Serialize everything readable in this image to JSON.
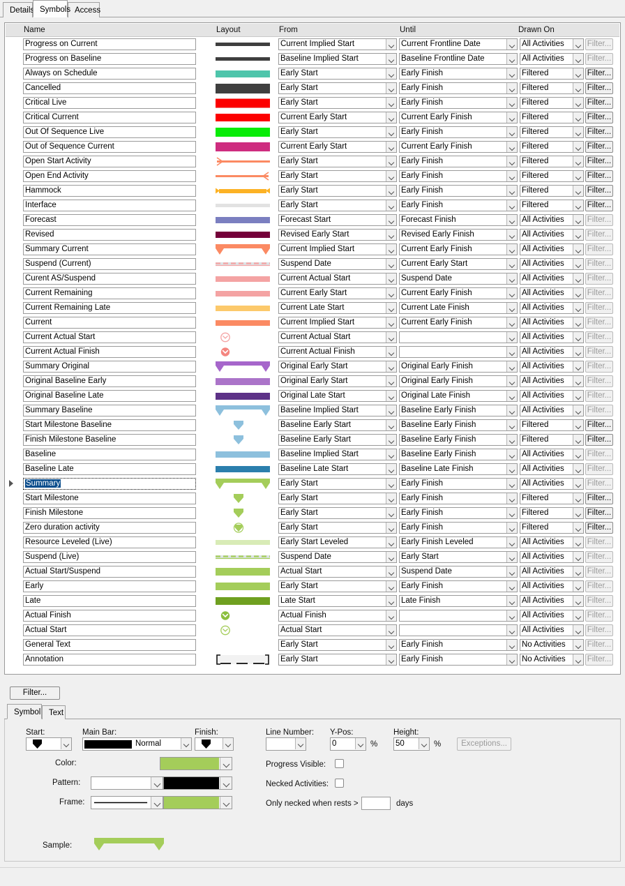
{
  "tabs": [
    {
      "label": "Details",
      "active": false
    },
    {
      "label": "Symbols",
      "active": true
    },
    {
      "label": "Access",
      "active": false
    }
  ],
  "grid": {
    "columns": [
      {
        "key": "name",
        "label": "Name"
      },
      {
        "key": "layout",
        "label": "Layout"
      },
      {
        "key": "from",
        "label": "From"
      },
      {
        "key": "until",
        "label": "Until"
      },
      {
        "key": "drawn_on",
        "label": "Drawn On"
      },
      {
        "key": "filter",
        "label": ""
      }
    ],
    "filter_button_label": "Filter...",
    "rows": [
      {
        "name": "Progress on Current",
        "from": "Current Implied Start",
        "until": "Current Frontline Date",
        "drawn_on": "All Activities",
        "filter_enabled": false,
        "selected": false,
        "sym": {
          "kind": "bar",
          "color": "#3f3f3f",
          "h": 5
        }
      },
      {
        "name": "Progress on Baseline",
        "from": "Baseline Implied Start",
        "until": "Baseline Frontline Date",
        "drawn_on": "All Activities",
        "filter_enabled": false,
        "selected": false,
        "sym": {
          "kind": "bar",
          "color": "#3f3f3f",
          "h": 5
        }
      },
      {
        "name": "Always on Schedule",
        "from": "Early Start",
        "until": "Early Finish",
        "drawn_on": "Filtered",
        "filter_enabled": true,
        "selected": false,
        "sym": {
          "kind": "bar",
          "color": "#4ec5ab",
          "h": 10
        }
      },
      {
        "name": "Cancelled",
        "from": "Early Start",
        "until": "Early Finish",
        "drawn_on": "Filtered",
        "filter_enabled": true,
        "selected": false,
        "sym": {
          "kind": "bar",
          "color": "#3f3f3f",
          "h": 14
        }
      },
      {
        "name": "Critical Live",
        "from": "Early Start",
        "until": "Early Finish",
        "drawn_on": "Filtered",
        "filter_enabled": true,
        "selected": false,
        "sym": {
          "kind": "bar",
          "color": "#fc0000",
          "h": 12,
          "frame": "#f08080"
        }
      },
      {
        "name": "Critical Current",
        "from": "Current Early Start",
        "until": "Current Early Finish",
        "drawn_on": "Filtered",
        "filter_enabled": true,
        "selected": false,
        "sym": {
          "kind": "bar",
          "color": "#fc0000",
          "h": 11
        }
      },
      {
        "name": "Out Of Sequence Live",
        "from": "Early Start",
        "until": "Early Finish",
        "drawn_on": "Filtered",
        "filter_enabled": true,
        "selected": false,
        "sym": {
          "kind": "bar",
          "color": "#08ec08",
          "h": 13
        }
      },
      {
        "name": "Out of Sequence Current",
        "from": "Current Early Start",
        "until": "Current Early Finish",
        "drawn_on": "Filtered",
        "filter_enabled": true,
        "selected": false,
        "sym": {
          "kind": "bar",
          "color": "#ce2d7f",
          "h": 13
        }
      },
      {
        "name": "Open Start Activity",
        "from": "Early Start",
        "until": "Early Finish",
        "drawn_on": "Filtered",
        "filter_enabled": true,
        "selected": false,
        "sym": {
          "kind": "open-start",
          "color": "#fb8a63",
          "h": 3
        }
      },
      {
        "name": "Open End Activity",
        "from": "Early Start",
        "until": "Early Finish",
        "drawn_on": "Filtered",
        "filter_enabled": true,
        "selected": false,
        "sym": {
          "kind": "open-end",
          "color": "#fb8a63",
          "h": 3
        }
      },
      {
        "name": "Hammock",
        "from": "Early Start",
        "until": "Early Finish",
        "drawn_on": "Filtered",
        "filter_enabled": true,
        "selected": false,
        "sym": {
          "kind": "hammock",
          "color": "#fcb225",
          "h": 6
        }
      },
      {
        "name": "Interface",
        "from": "Early Start",
        "until": "Early Finish",
        "drawn_on": "Filtered",
        "filter_enabled": true,
        "selected": false,
        "sym": {
          "kind": "bar",
          "color": "#e2e2e2",
          "h": 5
        }
      },
      {
        "name": "Forecast",
        "from": "Forecast Start",
        "until": "Forecast Finish",
        "drawn_on": "All Activities",
        "filter_enabled": false,
        "selected": false,
        "sym": {
          "kind": "bar",
          "color": "#7b7fc0",
          "h": 9
        }
      },
      {
        "name": "Revised",
        "from": "Revised Early Start",
        "until": "Revised Early Finish",
        "drawn_on": "All Activities",
        "filter_enabled": false,
        "selected": false,
        "sym": {
          "kind": "bar",
          "color": "#740039",
          "h": 9
        }
      },
      {
        "name": "Summary Current",
        "from": "Current Implied Start",
        "until": "Current Early Finish",
        "drawn_on": "All Activities",
        "filter_enabled": false,
        "selected": false,
        "sym": {
          "kind": "summary",
          "color": "#fb8a63",
          "h": 15
        }
      },
      {
        "name": "Suspend (Current)",
        "from": "Suspend Date",
        "until": "Current Early Start",
        "drawn_on": "All Activities",
        "filter_enabled": false,
        "selected": false,
        "sym": {
          "kind": "dashed",
          "color": "#f4a3a3",
          "h": 5
        }
      },
      {
        "name": "Curent AS/Suspend",
        "from": "Current Actual Start",
        "until": "Suspend Date",
        "drawn_on": "All Activities",
        "filter_enabled": false,
        "selected": false,
        "sym": {
          "kind": "bar",
          "color": "#f4a3a3",
          "h": 8
        }
      },
      {
        "name": "Current Remaining",
        "from": "Current Early Start",
        "until": "Current Early Finish",
        "drawn_on": "All Activities",
        "filter_enabled": false,
        "selected": false,
        "sym": {
          "kind": "bar",
          "color": "#f4a3a3",
          "h": 8
        }
      },
      {
        "name": "Current Remaining Late",
        "from": "Current Late Start",
        "until": "Current Late Finish",
        "drawn_on": "All Activities",
        "filter_enabled": false,
        "selected": false,
        "sym": {
          "kind": "bar",
          "color": "#fcc96b",
          "h": 8
        }
      },
      {
        "name": "Current",
        "from": "Current Implied Start",
        "until": "Current Early Finish",
        "drawn_on": "All Activities",
        "filter_enabled": false,
        "selected": false,
        "sym": {
          "kind": "bar",
          "color": "#fb8a63",
          "h": 8
        }
      },
      {
        "name": "Current Actual Start",
        "from": "Current Actual Start",
        "until": "",
        "drawn_on": "All Activities",
        "filter_enabled": false,
        "selected": false,
        "sym": {
          "kind": "circle-hollow",
          "color": "#f4a3a3",
          "h": 13
        }
      },
      {
        "name": "Current Actual Finish",
        "from": "Current Actual Finish",
        "until": "",
        "drawn_on": "All Activities",
        "filter_enabled": false,
        "selected": false,
        "sym": {
          "kind": "circle-solid",
          "color": "#f4857f",
          "h": 13
        }
      },
      {
        "name": "Summary Original",
        "from": "Original Early Start",
        "until": "Original Early Finish",
        "drawn_on": "All Activities",
        "filter_enabled": false,
        "selected": false,
        "sym": {
          "kind": "summary",
          "color": "#a666cb",
          "h": 15
        }
      },
      {
        "name": "Original Baseline Early",
        "from": "Original Early Start",
        "until": "Original Early Finish",
        "drawn_on": "All Activities",
        "filter_enabled": false,
        "selected": false,
        "sym": {
          "kind": "bar",
          "color": "#ab74c9",
          "h": 10
        }
      },
      {
        "name": "Original Baseline Late",
        "from": "Original Late Start",
        "until": "Original Late Finish",
        "drawn_on": "All Activities",
        "filter_enabled": false,
        "selected": false,
        "sym": {
          "kind": "bar",
          "color": "#5d3287",
          "h": 10
        }
      },
      {
        "name": "Summary Baseline",
        "from": "Baseline Implied Start",
        "until": "Baseline Early Finish",
        "drawn_on": "All Activities",
        "filter_enabled": false,
        "selected": false,
        "sym": {
          "kind": "summary",
          "color": "#8dc0dd",
          "h": 15
        }
      },
      {
        "name": "Start Milestone Baseline",
        "from": "Baseline Early Start",
        "until": "Baseline Early Finish",
        "drawn_on": "Filtered",
        "filter_enabled": true,
        "selected": false,
        "sym": {
          "kind": "milestone",
          "color": "#8dc0dd",
          "h": 13
        }
      },
      {
        "name": "Finish Milestone Baseline",
        "from": "Baseline Early Start",
        "until": "Baseline Early Finish",
        "drawn_on": "Filtered",
        "filter_enabled": true,
        "selected": false,
        "sym": {
          "kind": "milestone",
          "color": "#8dc0dd",
          "h": 13
        }
      },
      {
        "name": "Baseline",
        "from": "Baseline Implied Start",
        "until": "Baseline Early Finish",
        "drawn_on": "All Activities",
        "filter_enabled": false,
        "selected": false,
        "sym": {
          "kind": "bar",
          "color": "#8dc0dd",
          "h": 9
        }
      },
      {
        "name": "Baseline Late",
        "from": "Baseline Late Start",
        "until": "Baseline Late Finish",
        "drawn_on": "All Activities",
        "filter_enabled": false,
        "selected": false,
        "sym": {
          "kind": "bar",
          "color": "#2b7fad",
          "h": 9
        }
      },
      {
        "name": "Summary",
        "from": "Early Start",
        "until": "Early Finish",
        "drawn_on": "All Activities",
        "filter_enabled": false,
        "selected": true,
        "sym": {
          "kind": "summary",
          "color": "#a4cd5a",
          "h": 15
        }
      },
      {
        "name": "Start Milestone",
        "from": "Early Start",
        "until": "Early Finish",
        "drawn_on": "Filtered",
        "filter_enabled": true,
        "selected": false,
        "sym": {
          "kind": "milestone",
          "color": "#a4cd5a",
          "h": 13
        }
      },
      {
        "name": "Finish Milestone",
        "from": "Early Start",
        "until": "Early Finish",
        "drawn_on": "Filtered",
        "filter_enabled": true,
        "selected": false,
        "sym": {
          "kind": "milestone",
          "color": "#a4cd5a",
          "h": 13
        }
      },
      {
        "name": "Zero duration activity",
        "from": "Early Start",
        "until": "Early Finish",
        "drawn_on": "Filtered",
        "filter_enabled": true,
        "selected": false,
        "sym": {
          "kind": "zero-dur",
          "color": "#a4cd5a",
          "h": 14
        }
      },
      {
        "name": "Resource Leveled (Live)",
        "from": "Early Start Leveled",
        "until": "Early Finish Leveled",
        "drawn_on": "All Activities",
        "filter_enabled": false,
        "selected": false,
        "sym": {
          "kind": "bar",
          "color": "#d8ebb6",
          "h": 7
        }
      },
      {
        "name": "Suspend (Live)",
        "from": "Suspend Date",
        "until": "Early Start",
        "drawn_on": "All Activities",
        "filter_enabled": false,
        "selected": false,
        "sym": {
          "kind": "dashed",
          "color": "#a4cd5a",
          "h": 5
        }
      },
      {
        "name": "Actual Start/Suspend",
        "from": "Actual Start",
        "until": "Suspend Date",
        "drawn_on": "All Activities",
        "filter_enabled": false,
        "selected": false,
        "sym": {
          "kind": "bar",
          "color": "#a4cd5a",
          "h": 11
        }
      },
      {
        "name": "Early",
        "from": "Early Start",
        "until": "Early Finish",
        "drawn_on": "All Activities",
        "filter_enabled": false,
        "selected": false,
        "sym": {
          "kind": "bar",
          "color": "#a4cd5a",
          "h": 11
        }
      },
      {
        "name": "Late",
        "from": "Late Start",
        "until": "Late Finish",
        "drawn_on": "All Activities",
        "filter_enabled": false,
        "selected": false,
        "sym": {
          "kind": "bar",
          "color": "#6fa020",
          "h": 11
        }
      },
      {
        "name": "Actual Finish",
        "from": "Actual Finish",
        "until": "",
        "drawn_on": "All Activities",
        "filter_enabled": false,
        "selected": false,
        "sym": {
          "kind": "circle-solid",
          "color": "#8cbf3f",
          "h": 13
        }
      },
      {
        "name": "Actual Start",
        "from": "Actual Start",
        "until": "",
        "drawn_on": "All Activities",
        "filter_enabled": false,
        "selected": false,
        "sym": {
          "kind": "circle-hollow",
          "color": "#a4cd5a",
          "h": 13
        }
      },
      {
        "name": "General Text",
        "from": "Early Start",
        "until": "Early Finish",
        "drawn_on": "No Activities",
        "filter_enabled": false,
        "selected": false,
        "sym": {
          "kind": "none"
        }
      },
      {
        "name": "Annotation",
        "from": "Early Start",
        "until": "Early Finish",
        "drawn_on": "No Activities",
        "filter_enabled": false,
        "selected": false,
        "sym": {
          "kind": "annotation",
          "color": "#f0f0f0",
          "h": 13
        }
      }
    ]
  },
  "bottom": {
    "filter_button_label": "Filter...",
    "subtabs": [
      {
        "label": "Symbol",
        "active": true
      },
      {
        "label": "Text",
        "active": false
      }
    ],
    "symbol": {
      "start_label": "Start:",
      "start_marker": "pennant-down",
      "main_bar_label": "Main Bar:",
      "main_bar_value": "Normal",
      "main_bar_swatch": "#000000",
      "finish_label": "Finish:",
      "finish_marker": "pennant-down",
      "color_label": "Color:",
      "color_value": "#a4cd5a",
      "pattern_label": "Pattern:",
      "pattern_value": "#ffffff",
      "pattern_color_value": "#000000",
      "frame_label": "Frame:",
      "frame_line": "solid",
      "frame_color_value": "#a4cd5a",
      "line_number_label": "Line Number:",
      "line_number_value": "",
      "ypos_label": "Y-Pos:",
      "ypos_value": "0",
      "ypos_unit": "%",
      "height_label": "Height:",
      "height_value": "50",
      "height_unit": "%",
      "exceptions_label": "Exceptions...",
      "progress_visible_label": "Progress Visible:",
      "progress_visible_checked": false,
      "necked_activities_label": "Necked Activities:",
      "necked_activities_checked": false,
      "only_necked_label": "Only necked when rests >",
      "only_necked_value": "",
      "days_label": "days",
      "sample_label": "Sample:",
      "sample_kind": "summary",
      "sample_color": "#a4cd5a"
    }
  }
}
